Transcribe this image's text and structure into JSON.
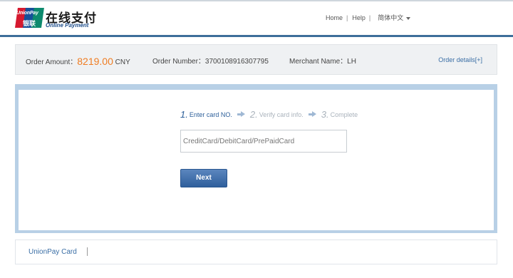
{
  "header": {
    "logo_en": "UnionPay",
    "logo_cn": "银联",
    "title": "在线支付",
    "subtitle": "Online Payment",
    "nav": {
      "home": "Home",
      "help": "Help",
      "language": "简体中文"
    }
  },
  "order": {
    "amount_label": "Order Amount：",
    "amount_value": "8219.00",
    "currency": "CNY",
    "number_label": "Order Number：",
    "number_value": "3700108916307795",
    "merchant_label": "Merchant Name：",
    "merchant_value": "LH",
    "details_link": "Order details[+]"
  },
  "steps": [
    {
      "num": "1.",
      "label": "Enter card NO.",
      "active": true
    },
    {
      "num": "2.",
      "label": "Verify card info.",
      "active": false
    },
    {
      "num": "3.",
      "label": "Complete",
      "active": false
    }
  ],
  "card_input": {
    "value": "",
    "placeholder": "CreditCard/DebitCard/PrePaidCard"
  },
  "next_button": "Next",
  "bottom_tabs": {
    "unionpay_card": "UnionPay Card"
  },
  "colors": {
    "accent_blue": "#2d5f9a",
    "amount_orange": "#ef7d23",
    "header_rule": "#3d6e9a"
  },
  "icons": {
    "step_arrow": "right-arrow-icon",
    "language_caret": "caret-down-icon"
  }
}
